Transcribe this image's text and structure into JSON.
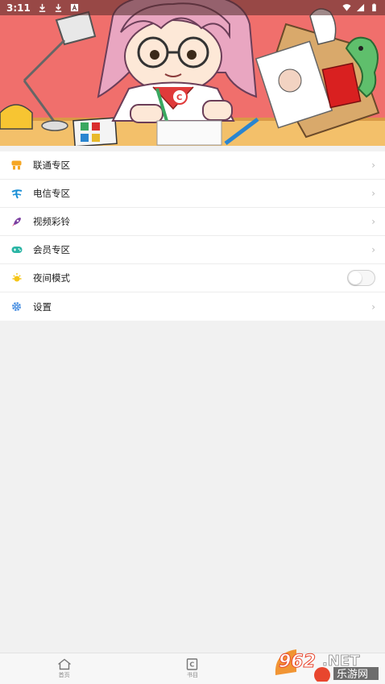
{
  "status_bar": {
    "time": "3:11",
    "icons": [
      "download-icon",
      "download-icon",
      "text-a-icon",
      "wifi-icon",
      "signal-icon",
      "battery-icon"
    ]
  },
  "banner": {
    "description_icon": "cartoon-illustration"
  },
  "menu": {
    "items": [
      {
        "label": "联通专区",
        "icon": "unicom-icon",
        "color": "#f5a623",
        "type": "link"
      },
      {
        "label": "电信专区",
        "icon": "telecom-icon",
        "color": "#1a8fd6",
        "type": "link"
      },
      {
        "label": "视频彩铃",
        "icon": "rocket-icon",
        "color": "#7b3fa0",
        "type": "link"
      },
      {
        "label": "会员专区",
        "icon": "gamepad-icon",
        "color": "#2bb5a5",
        "type": "link"
      },
      {
        "label": "夜间模式",
        "icon": "sun-icon",
        "color": "#f5c518",
        "type": "toggle",
        "enabled": false
      },
      {
        "label": "设置",
        "icon": "gear-icon",
        "color": "#4a90e2",
        "type": "link"
      }
    ]
  },
  "bottom_nav": {
    "items": [
      {
        "label": "首页",
        "icon": "home-icon"
      },
      {
        "label": "书目",
        "icon": "book-icon"
      }
    ]
  },
  "watermark": {
    "brand_number": "962",
    "brand_suffix": ".NET",
    "brand_sub": "乐游网"
  },
  "colors": {
    "banner_bg": "#f06f6c",
    "page_bg": "#f1f1f1",
    "accent": "#e8462e"
  }
}
